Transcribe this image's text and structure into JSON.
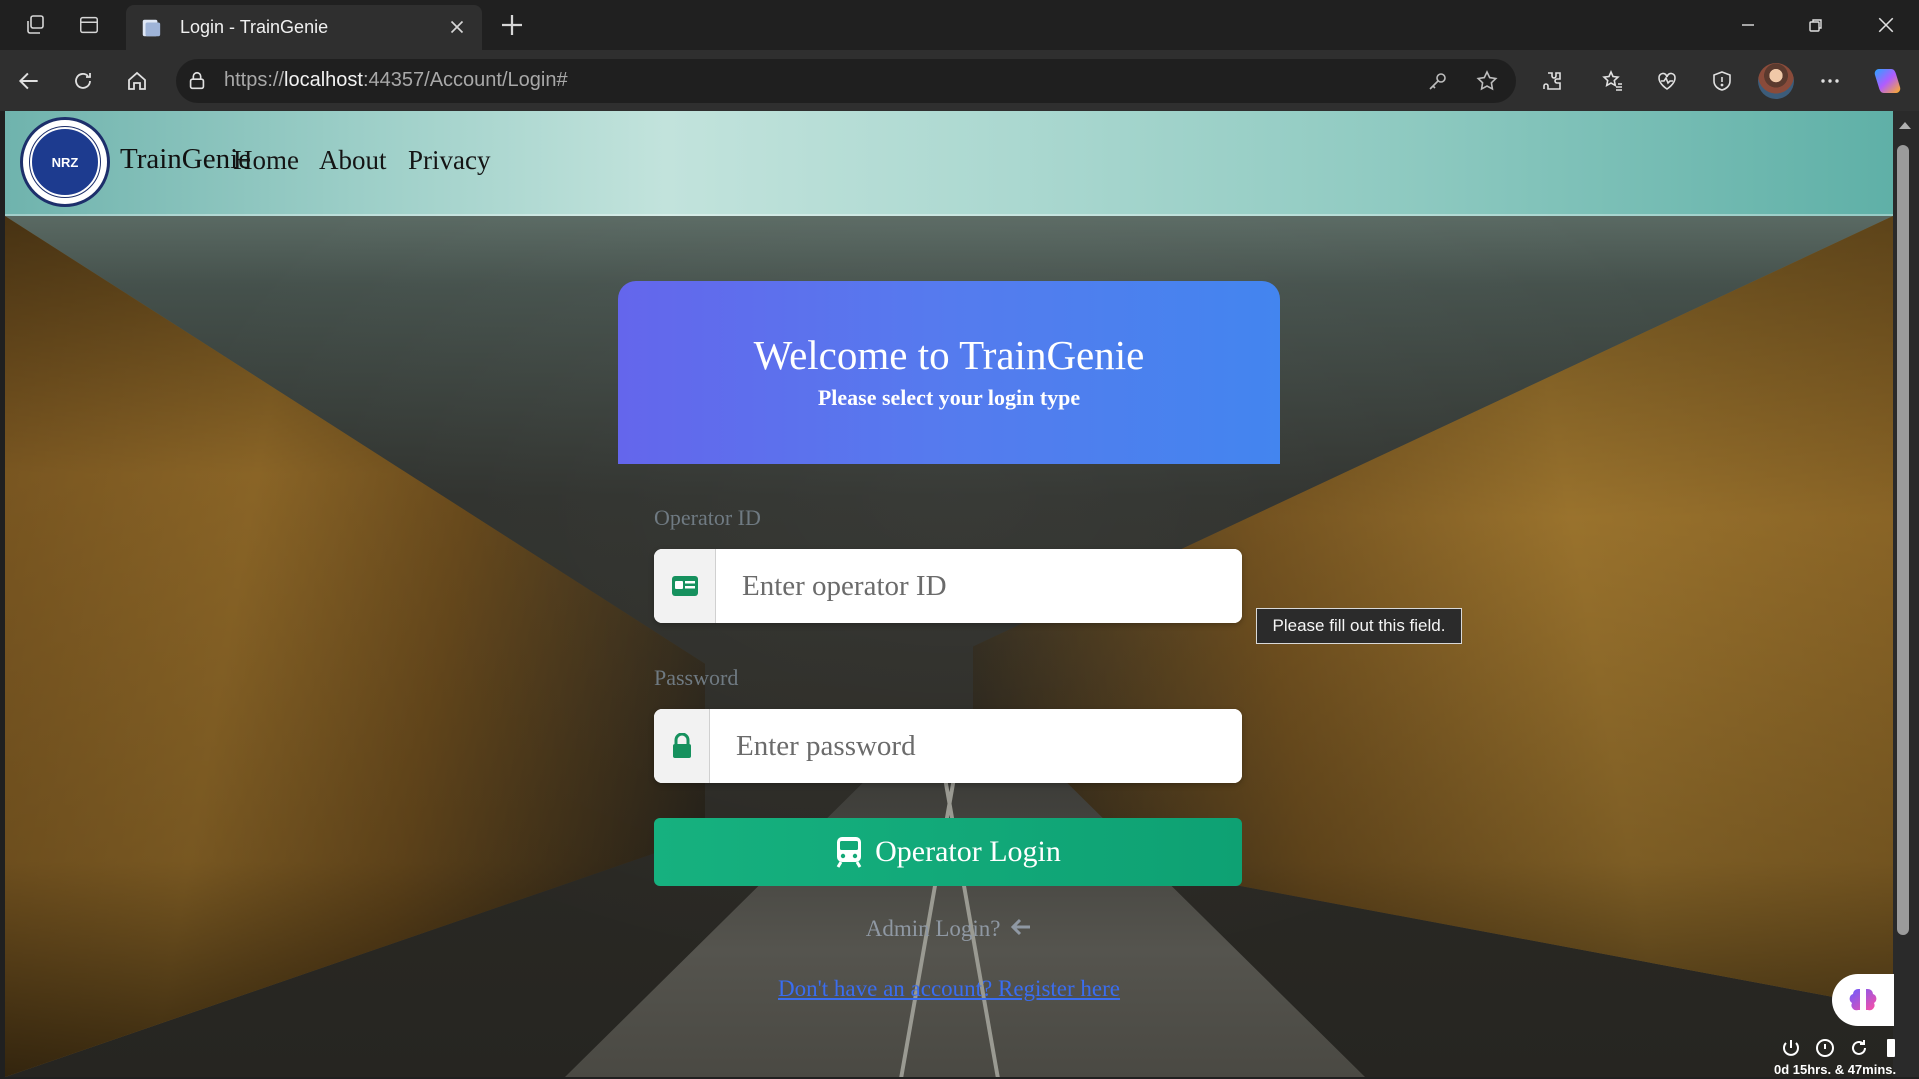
{
  "browser": {
    "tab_title": "Login - TrainGenie",
    "url_prefix": "https://",
    "url_host": "localhost",
    "url_rest": ":44357/Account/Login#"
  },
  "navbar": {
    "logo_text": "NRZ",
    "brand": "TrainGenie",
    "links": [
      "Home",
      "About",
      "Privacy"
    ]
  },
  "login": {
    "title": "Welcome to TrainGenie",
    "subtitle": "Please select your login type",
    "operator_label": "Operator ID",
    "operator_placeholder": "Enter operator ID",
    "password_label": "Password",
    "password_placeholder": "Enter password",
    "tooltip": "Please fill out this field.",
    "submit_label": "Operator Login",
    "admin_link": "Admin Login?",
    "register_link": "Don't have an account? Register here"
  },
  "tray": {
    "uptime": "0d 15hrs. & 47mins."
  },
  "colors": {
    "accent_green": "#16b17f",
    "header_gradient_start": "#6466ec",
    "header_gradient_end": "#4385ef",
    "link_blue": "#3a6df0"
  }
}
